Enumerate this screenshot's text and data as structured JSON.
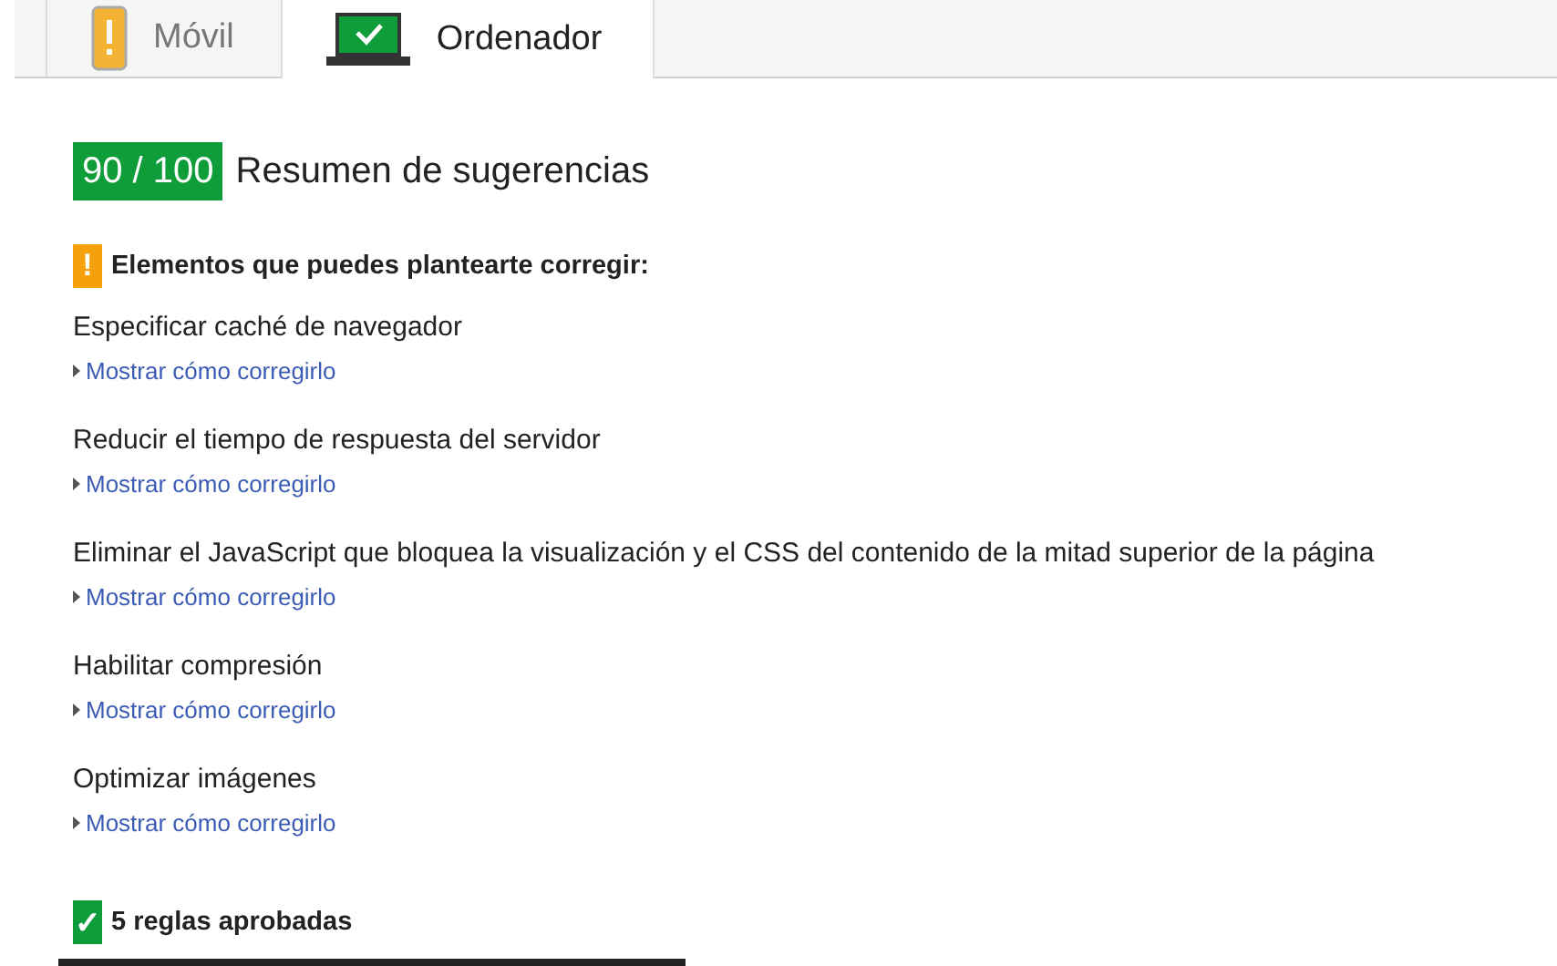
{
  "tabs": [
    {
      "label": "Móvil",
      "kind": "phone",
      "selected": false
    },
    {
      "label": "Ordenador",
      "kind": "laptop",
      "selected": true
    }
  ],
  "score": "90 / 100",
  "summary_title": "Resumen de sugerencias",
  "sections": [
    {
      "kind": "warning",
      "icon": "!",
      "title": "Elementos que puedes plantearte corregir:",
      "rules": [
        {
          "title": "Especificar caché de navegador",
          "link": "Mostrar cómo corregirlo"
        },
        {
          "title": "Reducir el tiempo de respuesta del servidor",
          "link": "Mostrar cómo corregirlo"
        },
        {
          "title": "Eliminar el JavaScript que bloquea la visualización y el CSS del contenido de la mitad superior de la página",
          "link": "Mostrar cómo corregirlo"
        },
        {
          "title": "Habilitar compresión",
          "link": "Mostrar cómo corregirlo"
        },
        {
          "title": "Optimizar imágenes",
          "link": "Mostrar cómo corregirlo"
        }
      ]
    },
    {
      "kind": "passed",
      "icon": "✓",
      "title": "5 reglas aprobadas"
    }
  ]
}
